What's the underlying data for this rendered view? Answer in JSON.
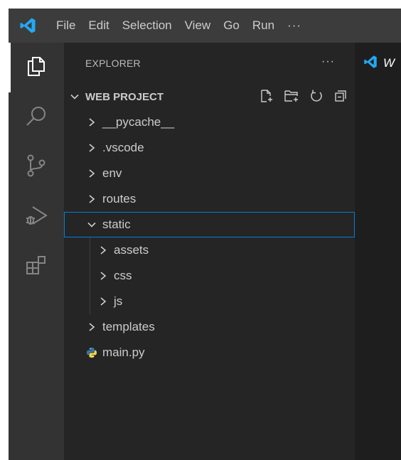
{
  "titlebar": {
    "menu": [
      "File",
      "Edit",
      "Selection",
      "View",
      "Go",
      "Run"
    ],
    "more": "···"
  },
  "activitybar": {
    "items": [
      {
        "icon": "files-icon",
        "active": true
      },
      {
        "icon": "search-icon",
        "active": false
      },
      {
        "icon": "source-control-icon",
        "active": false
      },
      {
        "icon": "run-debug-icon",
        "active": false
      },
      {
        "icon": "extensions-icon",
        "active": false
      }
    ]
  },
  "sidebar": {
    "title": "EXPLORER",
    "more": "···",
    "section": {
      "title": "WEB PROJECT",
      "actions": [
        "new-file-icon",
        "new-folder-icon",
        "refresh-icon",
        "collapse-all-icon"
      ]
    },
    "tree": [
      {
        "label": "__pycache__",
        "type": "folder",
        "expanded": false,
        "depth": 0
      },
      {
        "label": ".vscode",
        "type": "folder",
        "expanded": false,
        "depth": 0
      },
      {
        "label": "env",
        "type": "folder",
        "expanded": false,
        "depth": 0
      },
      {
        "label": "routes",
        "type": "folder",
        "expanded": false,
        "depth": 0
      },
      {
        "label": "static",
        "type": "folder",
        "expanded": true,
        "depth": 0,
        "selected": true
      },
      {
        "label": "assets",
        "type": "folder",
        "expanded": false,
        "depth": 1
      },
      {
        "label": "css",
        "type": "folder",
        "expanded": false,
        "depth": 1
      },
      {
        "label": "js",
        "type": "folder",
        "expanded": false,
        "depth": 1
      },
      {
        "label": "templates",
        "type": "folder",
        "expanded": false,
        "depth": 0
      },
      {
        "label": "main.py",
        "type": "python-file",
        "depth": 0
      }
    ]
  },
  "editor": {
    "tab_label": "W"
  },
  "colors": {
    "accent": "#007fd4",
    "vscode_blue": "#23a9f2",
    "python_blue": "#3b77a8",
    "python_yellow": "#f6d44c"
  }
}
